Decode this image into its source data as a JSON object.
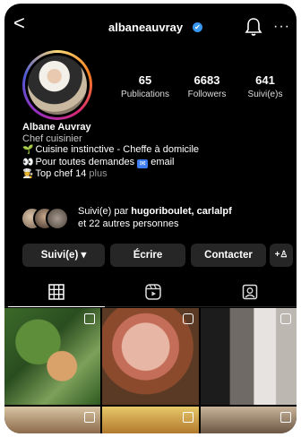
{
  "header": {
    "back": "<",
    "username": "albaneauvray",
    "verified": "✔",
    "more": "···"
  },
  "stats": {
    "posts": {
      "value": "65",
      "label": "Publications"
    },
    "followers": {
      "value": "6683",
      "label": "Followers"
    },
    "following": {
      "value": "641",
      "label": "Suivi(e)s"
    }
  },
  "bio": {
    "name": "Albane Auvray",
    "category": "Chef cuisinier",
    "line1": "Cuisine instinctive - Cheffe à domicile",
    "line2_prefix": "Pour toutes demandes",
    "line2_suffix": "email",
    "line3": "Top chef 14",
    "more": "plus"
  },
  "followed_by": {
    "prefix": "Suivi(e) par ",
    "names": "hugoriboulet, carlalpf",
    "suffix": "et 22 autres personnes"
  },
  "actions": {
    "following": "Suivi(e) ▾",
    "message": "Écrire",
    "contact": "Contacter",
    "add_user": "+♙"
  },
  "icons": {
    "back": "chevron-left-icon",
    "verified": "verified-badge-icon",
    "bell": "bell-icon",
    "more": "more-icon",
    "grid": "grid-icon",
    "reels": "reels-icon",
    "tagged": "tagged-icon"
  }
}
